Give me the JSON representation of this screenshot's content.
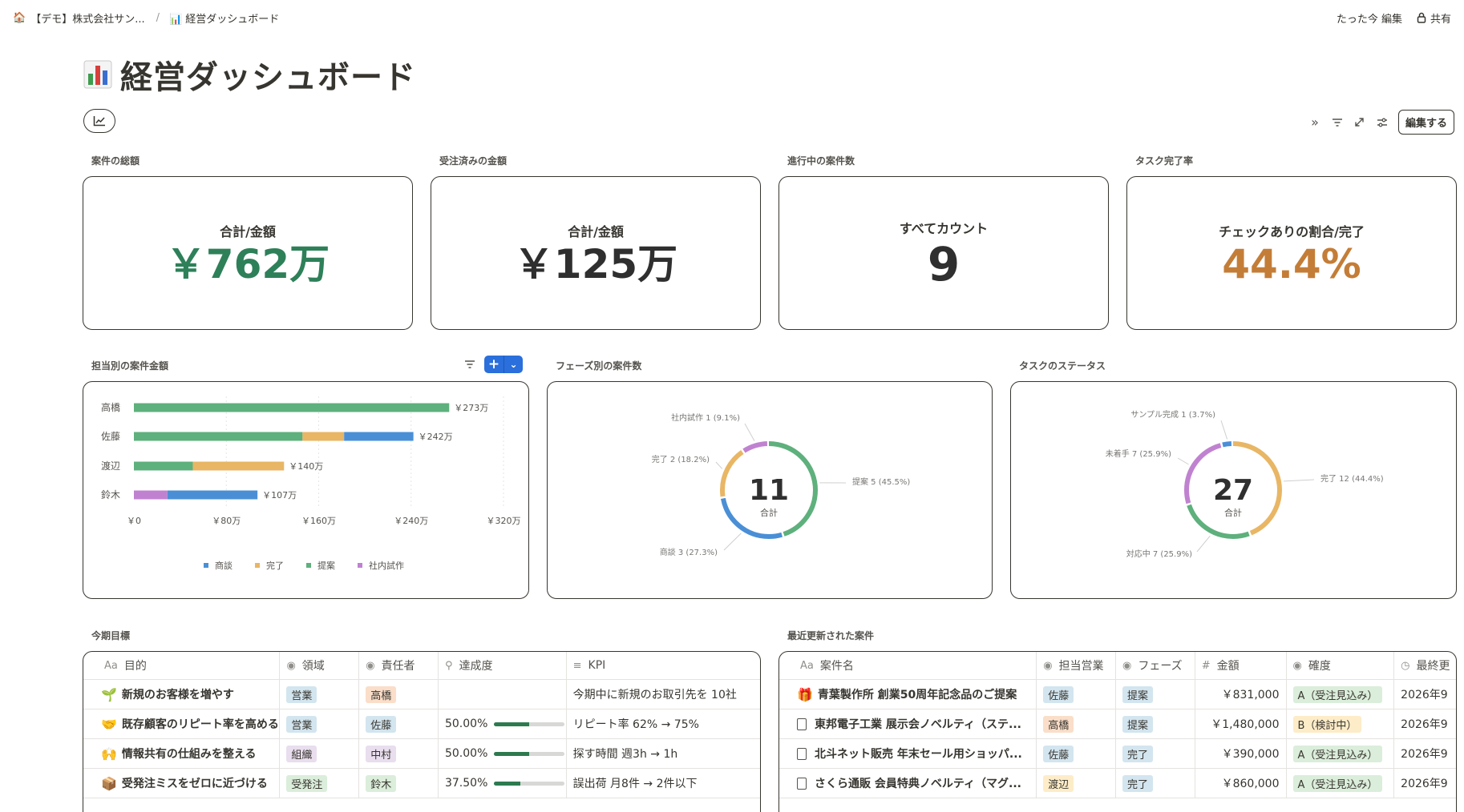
{
  "breadcrumb": {
    "workspace": "【デモ】株式会社サン...",
    "separator": "/",
    "page": "📊 経営ダッシュボード"
  },
  "topbar": {
    "edited": "たった今 編集",
    "share": "共有"
  },
  "page": {
    "title": "経営ダッシュボード"
  },
  "toolbar": {
    "edit": "編集する"
  },
  "kpis": [
    {
      "label": "案件の総額",
      "caption": "合計/金額",
      "value": "￥762万",
      "color": "#2e8059"
    },
    {
      "label": "受注済みの金額",
      "caption": "合計/金額",
      "value": "￥125万",
      "color": "#2f2f2f"
    },
    {
      "label": "進行中の案件数",
      "caption": "すべてカウント",
      "value": "9",
      "color": "#2f2f2f"
    },
    {
      "label": "タスク完了率",
      "caption": "チェックありの割合/完了",
      "value": "44.4%",
      "color": "#c47d37"
    }
  ],
  "widgets": {
    "bar": {
      "label": "担当別の案件金額"
    },
    "phase": {
      "label": "フェーズ別の案件数"
    },
    "task": {
      "label": "タスクのステータス"
    },
    "goals": {
      "label": "今期目標"
    },
    "recent": {
      "label": "最近更新された案件"
    }
  },
  "chart_data": [
    {
      "type": "bar",
      "orientation": "horizontal",
      "stacked": true,
      "categories": [
        "高橋",
        "佐藤",
        "渡辺",
        "鈴木"
      ],
      "series": [
        {
          "name": "商談",
          "color": "#4a8fd6",
          "values": [
            0,
            60,
            0,
            78
          ]
        },
        {
          "name": "完了",
          "color": "#e8b664",
          "values": [
            0,
            36,
            79,
            0
          ]
        },
        {
          "name": "提案",
          "color": "#5eb07c",
          "values": [
            273,
            146,
            51,
            0
          ]
        },
        {
          "name": "社内試作",
          "color": "#c082d0",
          "values": [
            0,
            0,
            0,
            29
          ]
        }
      ],
      "order": [
        "社内試作",
        "提案",
        "完了",
        "商談"
      ],
      "totals": [
        "￥273万",
        "￥242万",
        "￥140万",
        "￥107万"
      ],
      "xlim": [
        0,
        320
      ],
      "xticks": [
        "￥0",
        "￥80万",
        "￥160万",
        "￥240万",
        "￥320万"
      ],
      "legend": "bottom"
    },
    {
      "type": "pie",
      "donut": true,
      "center_value": "11",
      "center_label": "合計",
      "slices": [
        {
          "name": "提案",
          "value": 5,
          "pct": "45.5%",
          "color": "#5eb07c",
          "label": "提案 5 (45.5%)"
        },
        {
          "name": "商談",
          "value": 3,
          "pct": "27.3%",
          "color": "#4a8fd6",
          "label": "商談 3 (27.3%)"
        },
        {
          "name": "完了",
          "value": 2,
          "pct": "18.2%",
          "color": "#e8b664",
          "label": "完了 2 (18.2%)"
        },
        {
          "name": "社内試作",
          "value": 1,
          "pct": "9.1%",
          "color": "#c082d0",
          "label": "社内試作 1 (9.1%)"
        }
      ]
    },
    {
      "type": "pie",
      "donut": true,
      "center_value": "27",
      "center_label": "合計",
      "slices": [
        {
          "name": "完了",
          "value": 12,
          "pct": "44.4%",
          "color": "#e8b664",
          "label": "完了 12 (44.4%)"
        },
        {
          "name": "対応中",
          "value": 7,
          "pct": "25.9%",
          "color": "#5eb07c",
          "label": "対応中 7 (25.9%)"
        },
        {
          "name": "未着手",
          "value": 7,
          "pct": "25.9%",
          "color": "#c082d0",
          "label": "未着手 7 (25.9%)"
        },
        {
          "name": "サンプル完成",
          "value": 1,
          "pct": "3.7%",
          "color": "#4a8fd6",
          "label": "サンプル完成 1 (3.7%)"
        }
      ]
    }
  ],
  "goals": {
    "headers": [
      {
        "icon": "Aa",
        "label": "目的"
      },
      {
        "icon": "◉",
        "label": "領域"
      },
      {
        "icon": "◉",
        "label": "責任者"
      },
      {
        "icon": "⚲",
        "label": "達成度"
      },
      {
        "icon": "≡",
        "label": "KPI"
      }
    ],
    "rows": [
      {
        "emoji": "🌱",
        "name": "新規のお客様を増やす",
        "area": "営業",
        "area_color": "#d3e5ef",
        "owner": "高橋",
        "owner_color": "#fadec9",
        "progress": "",
        "pct": 0,
        "kpi": "今期中に新規のお取引先を 10社"
      },
      {
        "emoji": "🤝",
        "name": "既存顧客のリピート率を高める",
        "area": "営業",
        "area_color": "#d3e5ef",
        "owner": "佐藤",
        "owner_color": "#d3e5ef",
        "progress": "50.00%",
        "pct": 0.5,
        "kpi": "リピート率 62% → 75%"
      },
      {
        "emoji": "🙌",
        "name": "情報共有の仕組みを整える",
        "area": "組織",
        "area_color": "#e8deee",
        "owner": "中村",
        "owner_color": "#e8deee",
        "progress": "50.00%",
        "pct": 0.5,
        "kpi": "探す時間 週3h → 1h"
      },
      {
        "emoji": "📦",
        "name": "受発注ミスをゼロに近づける",
        "area": "受発注",
        "area_color": "#dbeddb",
        "owner": "鈴木",
        "owner_color": "#dbeddb",
        "progress": "37.50%",
        "pct": 0.375,
        "kpi": "誤出荷 月8件 → 2件以下"
      }
    ]
  },
  "recent": {
    "headers": [
      {
        "icon": "Aa",
        "label": "案件名"
      },
      {
        "icon": "◉",
        "label": "担当営業"
      },
      {
        "icon": "◉",
        "label": "フェーズ"
      },
      {
        "icon": "#",
        "label": "金額"
      },
      {
        "icon": "◉",
        "label": "確度"
      },
      {
        "icon": "◷",
        "label": "最終更"
      }
    ],
    "rows": [
      {
        "emoji": "🎁",
        "name": "青葉製作所 創業50周年記念品のご提案",
        "rep": "佐藤",
        "rep_color": "#d3e5ef",
        "phase": "提案",
        "phase_color": "#d3e5ef",
        "amount": "￥831,000",
        "conf": "A（受注見込み）",
        "conf_color": "#dbeddb",
        "date": "2026年9"
      },
      {
        "emoji": "",
        "name": "東邦電子工業 展示会ノベルティ（ステ...",
        "rep": "高橋",
        "rep_color": "#fadec9",
        "phase": "提案",
        "phase_color": "#d3e5ef",
        "amount": "￥1,480,000",
        "conf": "B（検討中）",
        "conf_color": "#fdecc8",
        "date": "2026年9"
      },
      {
        "emoji": "",
        "name": "北斗ネット販売 年末セール用ショッパ...",
        "rep": "佐藤",
        "rep_color": "#d3e5ef",
        "phase": "完了",
        "phase_color": "#d3e5ef",
        "amount": "￥390,000",
        "conf": "A（受注見込み）",
        "conf_color": "#dbeddb",
        "date": "2026年9"
      },
      {
        "emoji": "",
        "name": "さくら通販 会員特典ノベルティ（マグ...",
        "rep": "渡辺",
        "rep_color": "#fdecc8",
        "phase": "完了",
        "phase_color": "#d3e5ef",
        "amount": "￥860,000",
        "conf": "A（受注見込み）",
        "conf_color": "#dbeddb",
        "date": "2026年9"
      }
    ]
  }
}
